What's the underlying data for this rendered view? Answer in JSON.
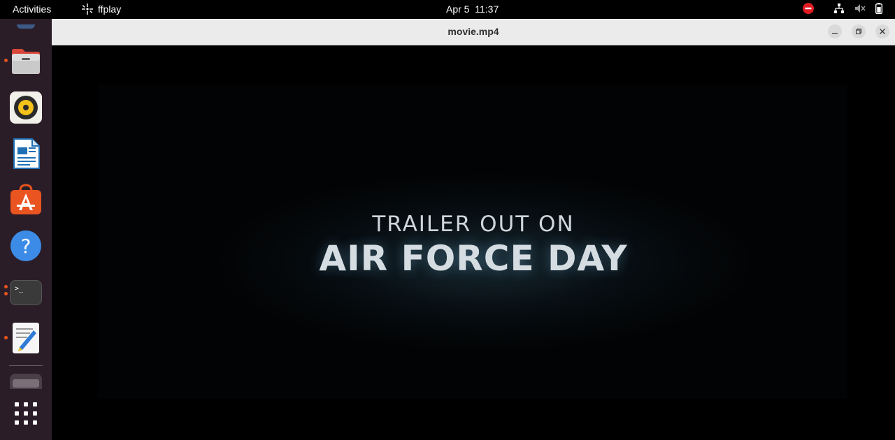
{
  "topbar": {
    "activities": "Activities",
    "app_name": "ffplay",
    "clock": "Apr 5  11:37"
  },
  "window": {
    "title": "movie.mp4"
  },
  "video": {
    "line1": "TRAILER OUT ON",
    "line2": "AIR FORCE DAY"
  },
  "dock": {
    "items": [
      "files",
      "rhythmbox",
      "libreoffice-writer",
      "app-center",
      "help",
      "terminal",
      "text-editor",
      "trash",
      "show-apps"
    ]
  },
  "colors": {
    "accent": "#e95420",
    "dock_bg": "#2b1d27",
    "titlebar_bg": "#ebebeb"
  }
}
